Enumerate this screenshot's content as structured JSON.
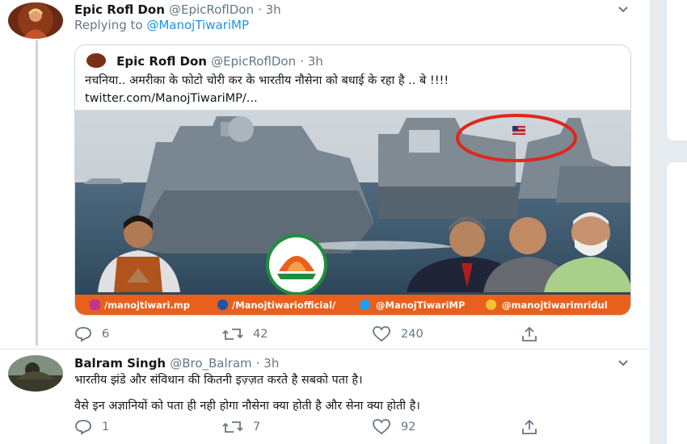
{
  "tweet1": {
    "author": "Epic Rofl Don",
    "handle": "@EpicRoflDon",
    "time": "· 3h",
    "replying_prefix": "Replying to",
    "replying_to": "@ManojTiwariMP",
    "quote": {
      "author": "Epic Rofl Don",
      "handle": "@EpicRoflDon",
      "time": "· 3h",
      "text": "नचनिया.. अमरीका के फोटो चोरी कर के भारतीय नौसेना को बधाई के रहा है .. बे !!!!",
      "link": "twitter.com/ManojTiwariMP/..."
    },
    "media_footer": {
      "instagram": "/manojtiwari.mp",
      "facebook": "/Manojtiwariofficial/",
      "twitter": "@ManojTiwariMP",
      "koo": "@manojtiwarimridul"
    },
    "actions": {
      "replies": "6",
      "retweets": "42",
      "likes": "240"
    }
  },
  "tweet2": {
    "author": "Balram Singh",
    "handle": "@Bro_Balram",
    "time": "· 3h",
    "line1": "भारतीय झंडे और संविधान की कितनी इज़्ज़त करते है सबको पता है।",
    "line2": "वैसे इन अज्ञानियों को पता ही नही होगा नौसेना क्या होती है और सेना क्या होती है।",
    "actions": {
      "replies": "1",
      "retweets": "7",
      "likes": "92"
    }
  },
  "colors": {
    "link_blue": "#1b95e0",
    "muted_gray": "#657786",
    "footer_orange": "#e8601c",
    "circle_red": "#e0271d"
  }
}
